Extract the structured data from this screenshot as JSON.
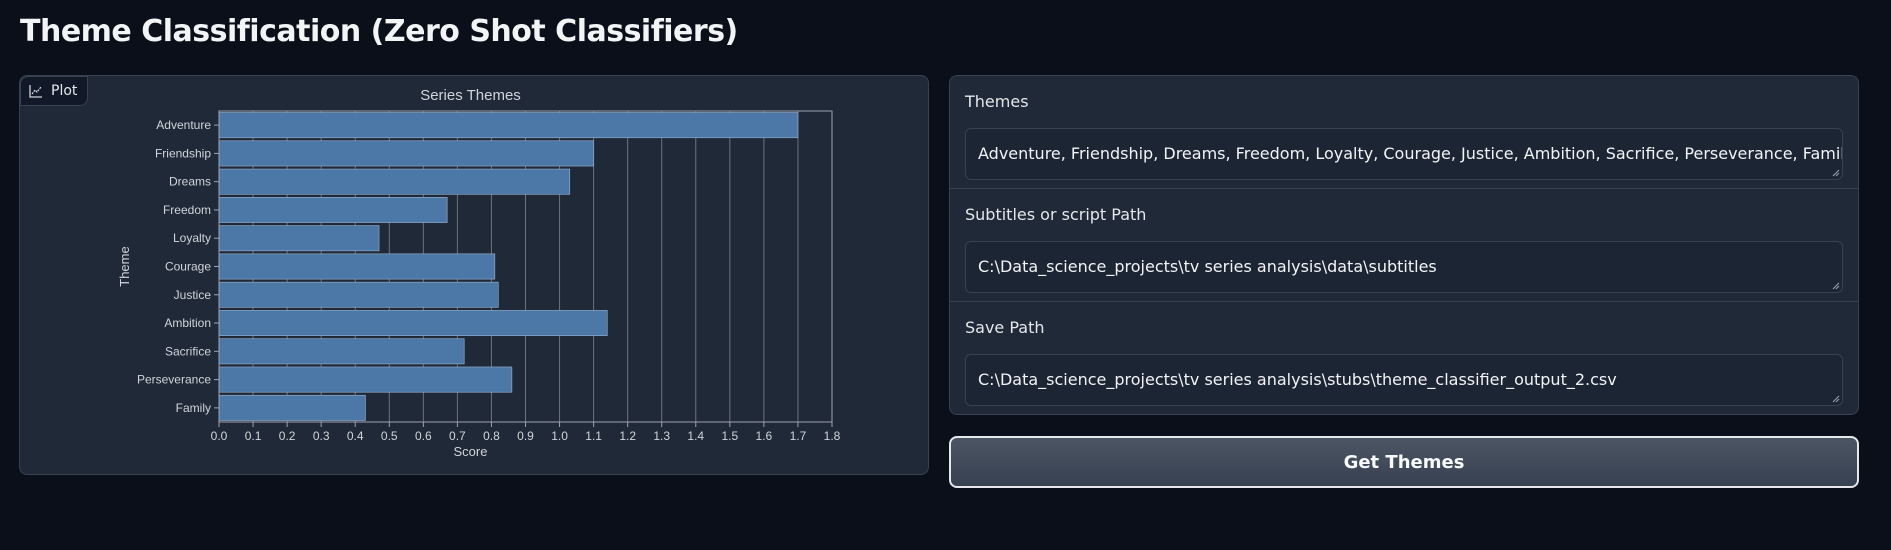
{
  "page": {
    "title": "Theme Classification (Zero Shot Classifiers)"
  },
  "plot": {
    "tag_label": "Plot",
    "tag_icon": "chart-icon"
  },
  "form": {
    "themes": {
      "label": "Themes",
      "value": "Adventure, Friendship, Dreams, Freedom, Loyalty, Courage, Justice, Ambition, Sacrifice, Perseverance, Family"
    },
    "subtitles": {
      "label": "Subtitles or script Path",
      "value": "C:\\Data_science_projects\\tv series analysis\\data\\subtitles"
    },
    "save": {
      "label": "Save Path",
      "value": "C:\\Data_science_projects\\tv series analysis\\stubs\\theme_classifier_output_2.csv"
    }
  },
  "button": {
    "label": "Get Themes"
  },
  "colors": {
    "background": "#0b0f19",
    "panel": "#1f2937",
    "bar": "#4c78a8"
  },
  "chart_data": {
    "type": "bar",
    "orientation": "horizontal",
    "title": "Series Themes",
    "xlabel": "Score",
    "ylabel": "Theme",
    "categories": [
      "Adventure",
      "Friendship",
      "Dreams",
      "Freedom",
      "Loyalty",
      "Courage",
      "Justice",
      "Ambition",
      "Sacrifice",
      "Perseverance",
      "Family"
    ],
    "values": [
      1.7,
      1.1,
      1.03,
      0.67,
      0.47,
      0.81,
      0.82,
      1.14,
      0.72,
      0.86,
      0.43
    ],
    "xlim": [
      0,
      1.8
    ],
    "xticks": [
      "0.0",
      "0.1",
      "0.2",
      "0.3",
      "0.4",
      "0.5",
      "0.6",
      "0.7",
      "0.8",
      "0.9",
      "1.0",
      "1.1",
      "1.2",
      "1.3",
      "1.4",
      "1.5",
      "1.6",
      "1.7",
      "1.8"
    ],
    "grid": true,
    "legend": "none"
  }
}
